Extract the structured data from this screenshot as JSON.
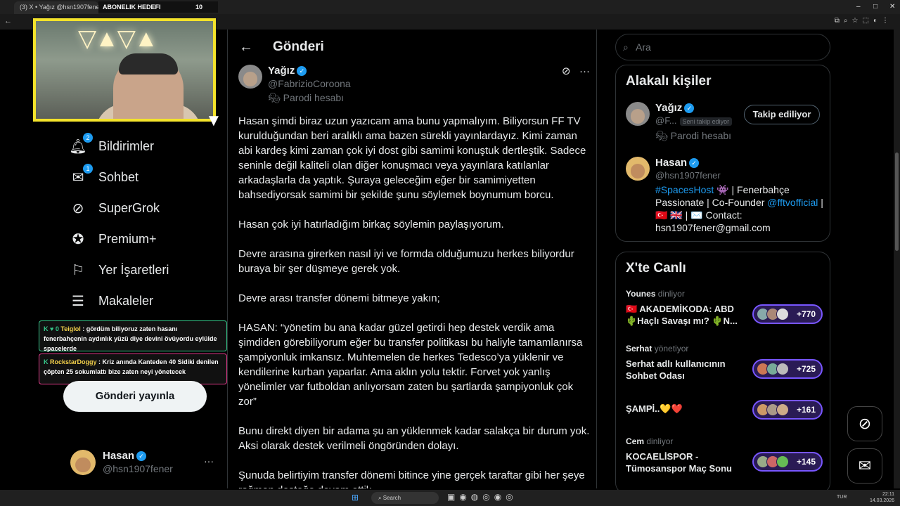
{
  "browser": {
    "tab_label": "(3) X • Yağız @hsn1907fener",
    "overlay_label": "ABONELIK HEDEFI",
    "overlay_value": "10",
    "win_min": "–",
    "win_max": "□",
    "win_close": "✕"
  },
  "sidebar": {
    "items": [
      {
        "label": "Bildirimler",
        "icon": "bell-icon",
        "badge": "2"
      },
      {
        "label": "Sohbet",
        "icon": "mail-icon",
        "badge": "1"
      },
      {
        "label": "SuperGrok",
        "icon": "grok-icon",
        "badge": ""
      },
      {
        "label": "Premium+",
        "icon": "verified-badge-icon",
        "badge": ""
      },
      {
        "label": "Yer İşaretleri",
        "icon": "bookmark-icon",
        "badge": ""
      },
      {
        "label": "Makaleler",
        "icon": "article-icon",
        "badge": ""
      }
    ],
    "post_button": "Gönderi yayınla",
    "profile": {
      "name": "Hasan",
      "handle": "@hsn1907fener",
      "more": "···"
    }
  },
  "stream_chat": {
    "msg1_badges": "K ♥ 0",
    "msg1_user": "Teiglol",
    "msg1_text": ": gördüm biliyoruz zaten hasanı fenerbahçenin aydınlık yüzü diye devini övüyordu eylülde spacelerde",
    "msg2_badges": "K",
    "msg2_user": "RockstarDoggy",
    "msg2_text": ": Kriz anında Kanteden 40 Sidiki denilen çöpten 25 sokumlattı bize zaten neyi yönetecek"
  },
  "main": {
    "header_title": "Gönderi",
    "author": {
      "name": "Yağız",
      "handle": "@FabrizioCoroona",
      "parody": "Parodi hesabı"
    },
    "paragraphs": [
      "Hasan şimdi biraz uzun yazıcam ama bunu yapmalıyım. Biliyorsun FF TV kurulduğundan beri aralıklı ama bazen sürekli yayınlardayız. Kimi zaman abi kardeş kimi zaman çok iyi dost gibi samimi konuştuk dertleştik. Sadece seninle değil kaliteli olan diğer konuşmacı veya yayınlara katılanlar arkadaşlarla da yaptık. Şuraya geleceğim eğer bir samimiyetten bahsediyorsak samimi bir şekilde şunu söylemek boynumum borcu.",
      "Hasan çok iyi hatırladığım birkaç söylemin paylaşıyorum.",
      "Devre arasına girerken nasıl iyi ve formda olduğumuzu herkes biliyordur buraya bir şer düşmeye gerek yok.",
      "Devre arası transfer dönemi bitmeye yakın;",
      "HASAN: “yönetim bu ana kadar güzel getirdi hep destek verdik ama şimdiden görebiliyorum eğer bu transfer politikası bu haliyle tamamlanırsa şampiyonluk imkansız. Muhtemelen de herkes Tedesco’ya yüklenir ve kendilerine kurban yaparlar. Ama aklın yolu tektir. Forvet yok yanlış yönelimler var futboldan anlıyorsam zaten bu şartlarda şampiyonluk çok zor”",
      "Bunu direkt diyen bir adama şu an yüklenmek kadar salakça bir durum yok. Aksi olarak destek verilmeli öngöründen dolayı.",
      "Şunuda belirtiyim transfer dönemi bitince yine gerçek taraftar gibi her şeye rağmen desteğe devam ettik."
    ]
  },
  "right": {
    "search_placeholder": "Ara",
    "related_title": "Alakalı kişiler",
    "person1": {
      "name": "Yağız",
      "handle": "@F...",
      "tag": "Seni takip ediyor",
      "sub": "Parodi hesabı",
      "button": "Takip ediliyor"
    },
    "person2": {
      "name": "Hasan",
      "handle": "@hsn1907fener",
      "bio_hashtag": "#SpacesHost",
      "bio_1": " 👾 | Fenerbahçe Passionate | Co-Founder ",
      "bio_link": "@fftvofficial",
      "bio_2": " | 🇹🇷 🇬🇧 | ✉️ Contact: hsn1907fener@gmail.com"
    },
    "live_title": "X'te Canlı",
    "spaces": [
      {
        "host": "Younes",
        "role": "dinliyor",
        "title": "🇹🇷 AKADEMİKODA: ABD 🌵Haçlı Savaşı mı? 🌵N...",
        "count": "+770"
      },
      {
        "host": "Serhat",
        "role": "yönetiyor",
        "title": "Serhat adlı kullanıcının Sohbet Odası",
        "count": "+725"
      },
      {
        "host": "",
        "role": "",
        "title": "ŞAMPİ..💛❤️",
        "count": "+161"
      },
      {
        "host": "Cem",
        "role": "dinliyor",
        "title": "KOCAELİSPOR - Tümosanspor Maç Sonu",
        "count": "+145"
      }
    ]
  },
  "taskbar": {
    "search": "Search",
    "lang": "TUR",
    "time": "22:11",
    "date": "14.03.2026"
  },
  "colors": {
    "accent": "#1d9bf0",
    "space_pill": "#7856ff",
    "overlay_border": "#f4e32b"
  }
}
